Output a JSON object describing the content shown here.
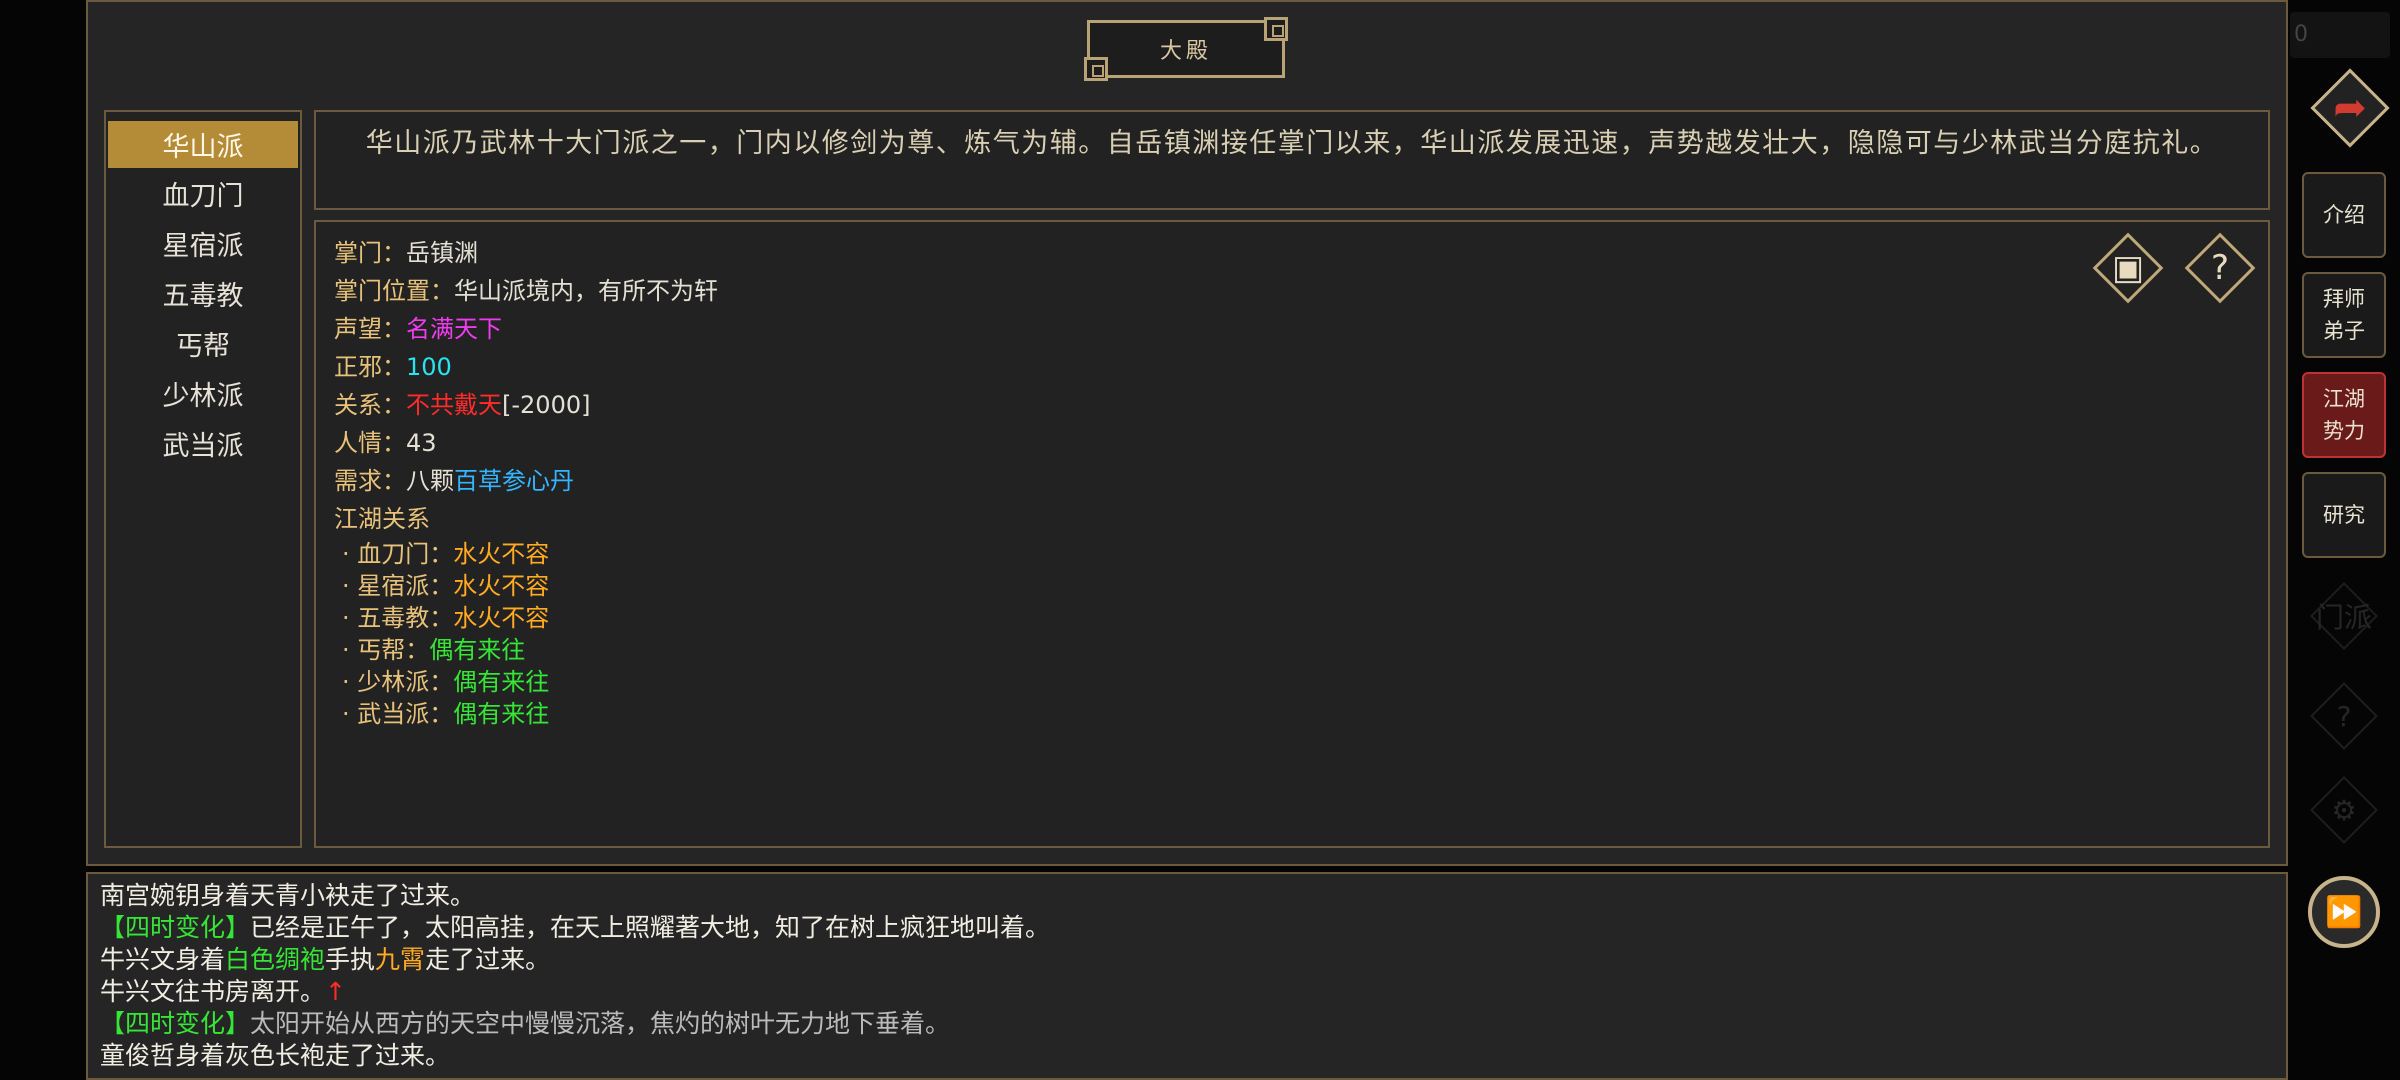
{
  "title": "大殿",
  "sects": [
    "华山派",
    "血刀门",
    "星宿派",
    "五毒教",
    "丐帮",
    "少林派",
    "武当派"
  ],
  "selected_sect": "华山派",
  "intro": "华山派乃武林十大门派之一，门内以修剑为尊、炼气为辅。自岳镇渊接任掌门以来，华山派发展迅速，声势越发壮大，隐隐可与少林武当分庭抗礼。",
  "details": {
    "leader_label": "掌门：",
    "leader": "岳镇渊",
    "location_label": "掌门位置：",
    "location": "华山派境内，有所不为轩",
    "prestige_label": "声望：",
    "prestige": "名满天下",
    "alignment_label": "正邪：",
    "alignment": "100",
    "relation_label": "关系：",
    "relation": "不共戴天",
    "relation_value": "[-2000]",
    "favor_label": "人情：",
    "favor": "43",
    "need_label": "需求：",
    "need_prefix": "八颗",
    "need_item": "百草参心丹",
    "jianghu_label": "江湖关系",
    "relations": [
      {
        "name": "· 血刀门：",
        "status": "水火不容",
        "color": "orange"
      },
      {
        "name": "· 星宿派：",
        "status": "水火不容",
        "color": "orange"
      },
      {
        "name": "· 五毒教：",
        "status": "水火不容",
        "color": "orange"
      },
      {
        "name": "· 丐帮：",
        "status": "偶有来往",
        "color": "green"
      },
      {
        "name": "· 少林派：",
        "status": "偶有来往",
        "color": "green"
      },
      {
        "name": "· 武当派：",
        "status": "偶有来往",
        "color": "green"
      }
    ]
  },
  "log": {
    "line1": "南宫婉钥身着天青小袂走了过来。",
    "line2_tag": "【四时变化】",
    "line2_text": "已经是正午了，太阳高挂，在天上照耀著大地，知了在树上疯狂地叫着。",
    "line3_a": "牛兴文身着",
    "line3_b": "白色绸袍",
    "line3_c": "手执",
    "line3_d": "九霄",
    "line3_e": "走了过来。",
    "line4_a": "牛兴文往书房离开。",
    "line4_arrow": "↑",
    "line5_tag": "【四时变化】",
    "line5_text": "太阳开始从西方的天空中慢慢沉落，焦灼的树叶无力地下垂着。",
    "line6": "童俊哲身着灰色长袍走了过来。"
  },
  "side_tabs": {
    "intro": "介绍",
    "apprentice": "拜师\n弟子",
    "factions": "江湖\n势力",
    "research": "研究"
  },
  "side_tabs_lines": {
    "apprentice": [
      "拜师",
      "弟子"
    ],
    "factions": [
      "江湖",
      "势力"
    ]
  },
  "ghost_icons": {
    "sect": "门派",
    "help": "?",
    "settings": "⚙"
  },
  "corner_text": "0",
  "colors": {
    "gold": "#e8c27a",
    "selected": "#b48c38",
    "active_tab": "#6b1a1a"
  }
}
